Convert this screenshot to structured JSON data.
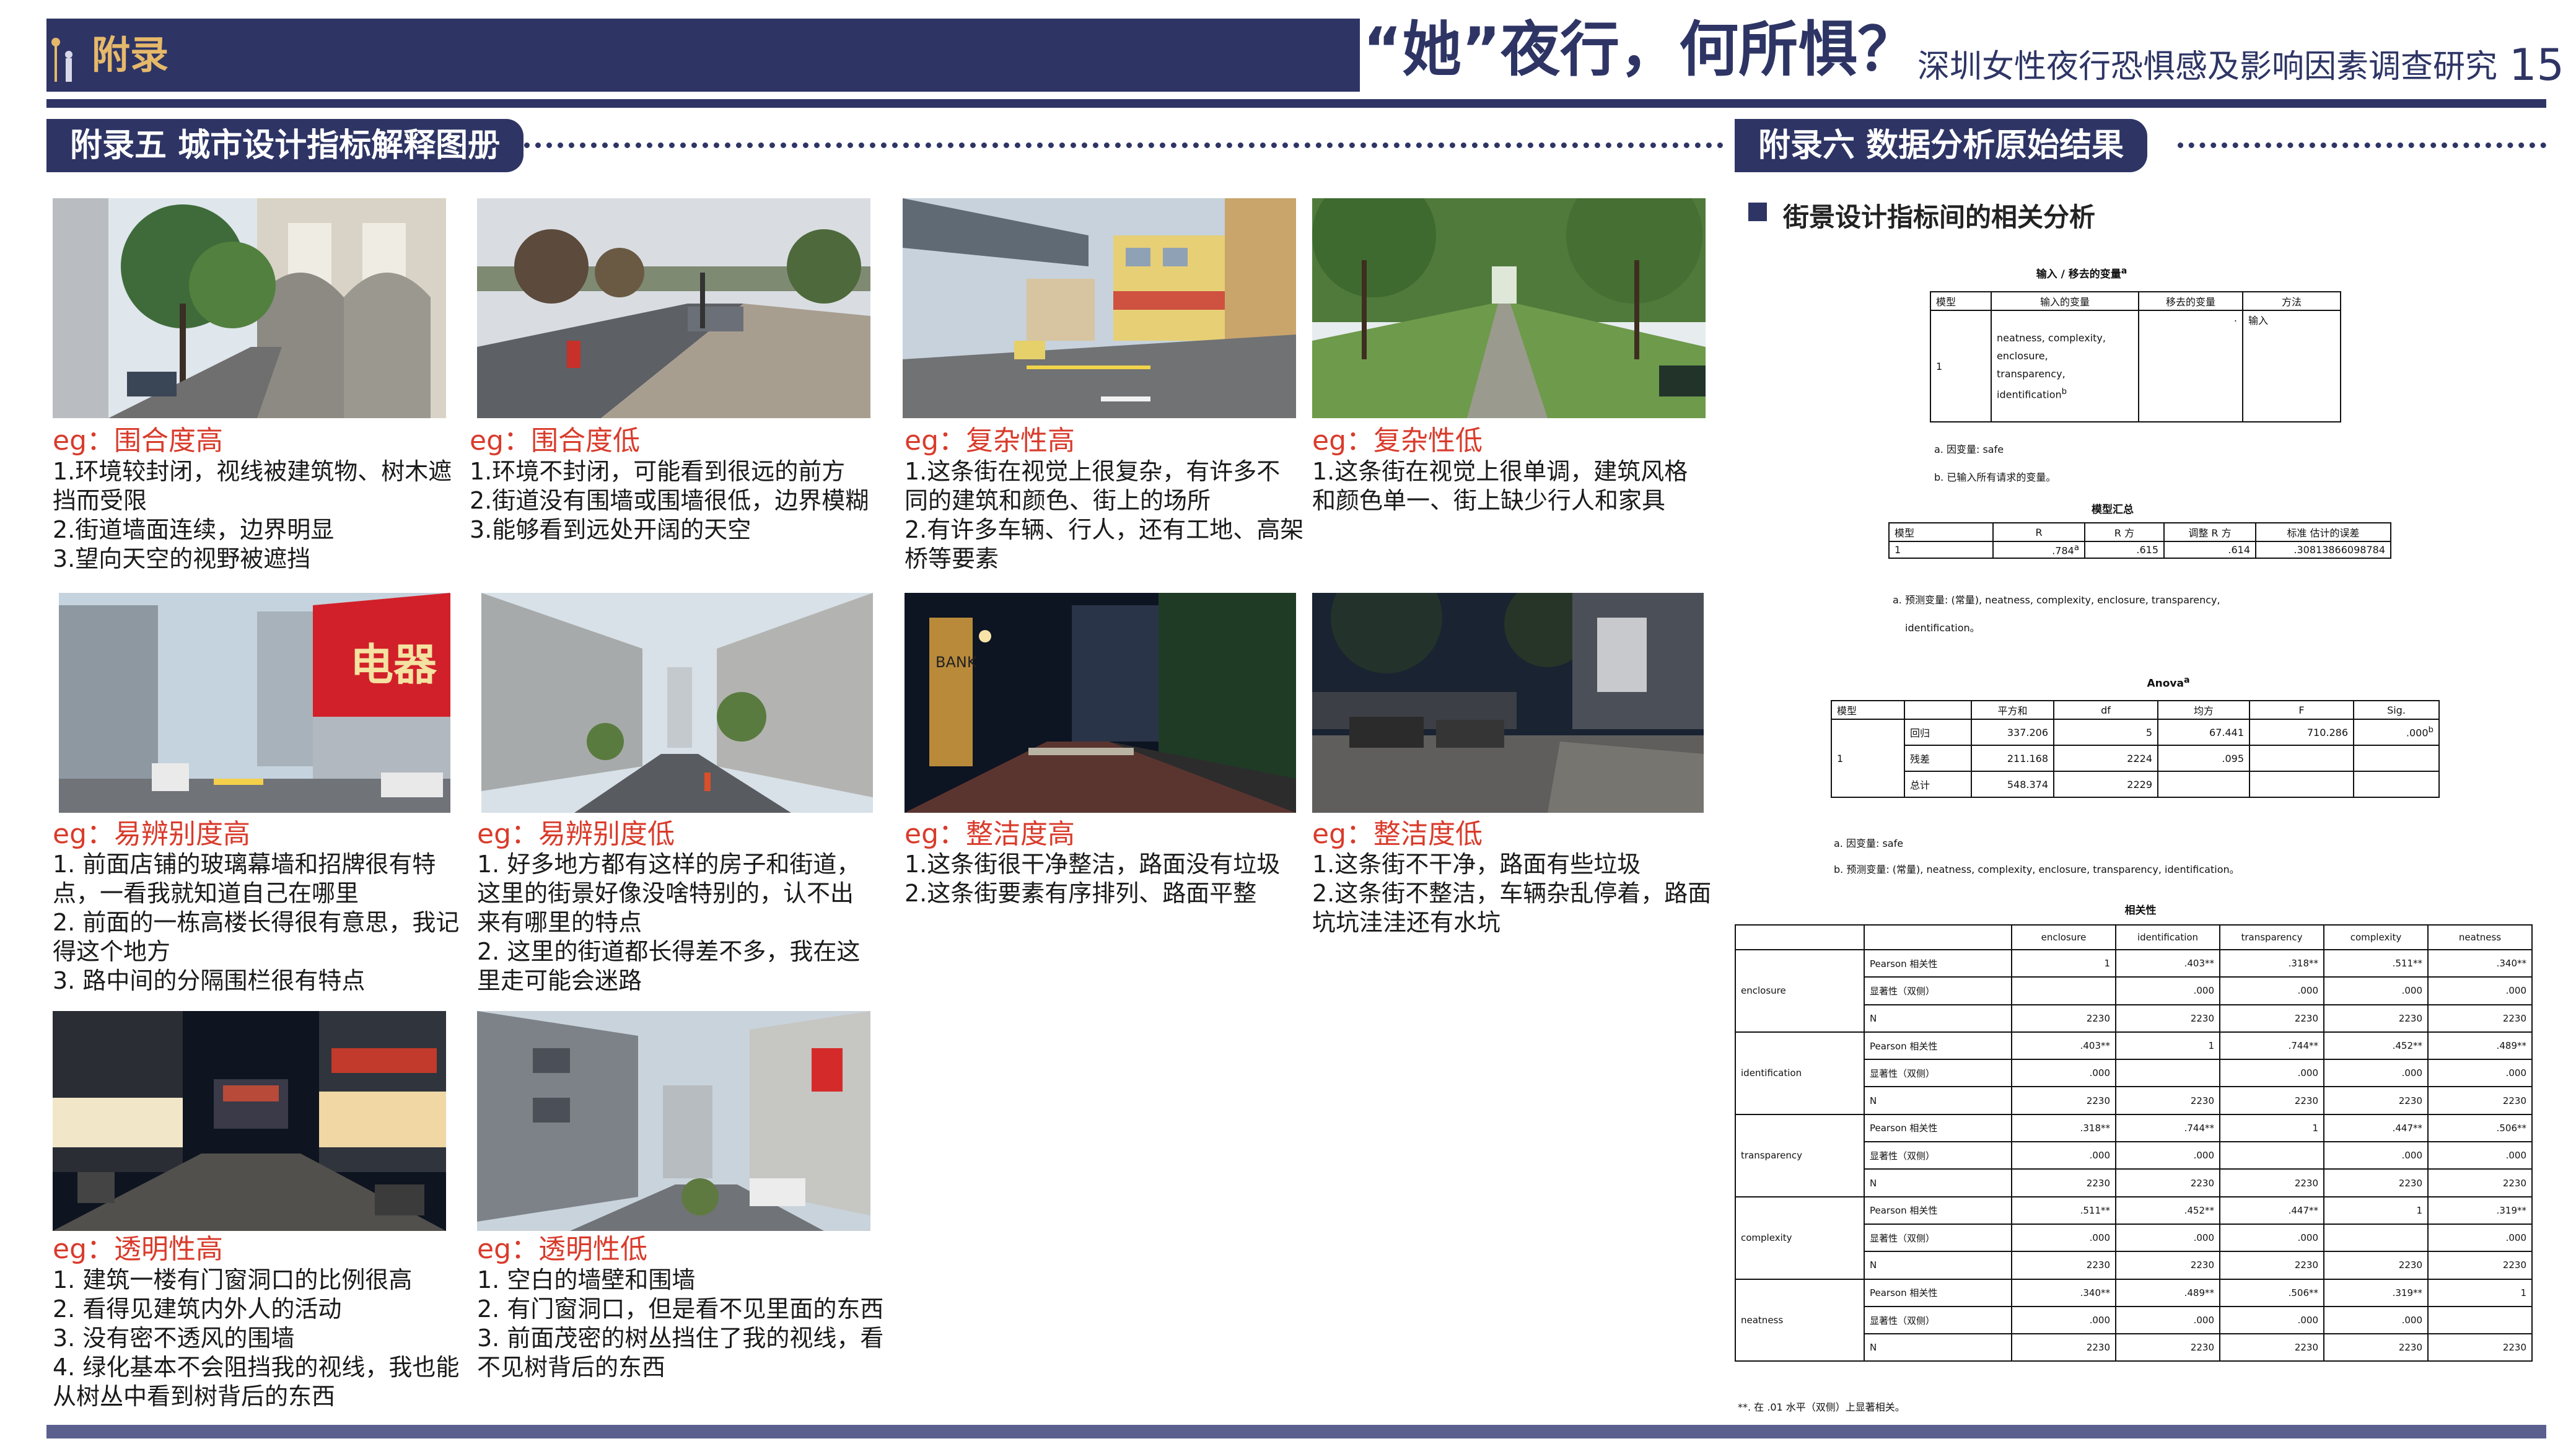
{
  "header": {
    "section": "附录",
    "slogan": "“她”夜行，何所惧？",
    "subtitle": "深圳女性夜行恐惧感及影响因素调查研究",
    "page": "15"
  },
  "appendix5": {
    "title": "附录五 城市设计指标解释图册",
    "cards": [
      {
        "caption": "eg：围合度高",
        "lines": [
          "1.环境较封闭，视线被建筑物、树木遮",
          "挡而受限",
          "2.街道墙面连续，边界明显",
          "3.望向天空的视野被遮挡"
        ]
      },
      {
        "caption": "eg：围合度低",
        "lines": [
          "1.环境不封闭，可能看到很远的前方",
          "2.街道没有围墙或围墙很低，边界模糊",
          "3.能够看到远处开阔的天空"
        ]
      },
      {
        "caption": "eg：复杂性高",
        "lines": [
          "1.这条街在视觉上很复杂，有许多不",
          "同的建筑和颜色、街上的场所",
          "2.有许多车辆、行人，还有工地、高架",
          "桥等要素"
        ]
      },
      {
        "caption": "eg：复杂性低",
        "lines": [
          "1.这条街在视觉上很单调，建筑风格",
          "和颜色单一、街上缺少行人和家具"
        ]
      },
      {
        "caption": "eg：易辨别度高",
        "lines": [
          "1. 前面店铺的玻璃幕墙和招牌很有特",
          "点，一看我就知道自己在哪里",
          "2. 前面的一栋高楼长得很有意思，我记",
          "得这个地方",
          "3. 路中间的分隔围栏很有特点"
        ]
      },
      {
        "caption": "eg：易辨别度低",
        "lines": [
          "1. 好多地方都有这样的房子和街道，",
          "这里的街景好像没啥特别的，认不出",
          "来有哪里的特点",
          "2. 这里的街道都长得差不多，我在这",
          "里走可能会迷路"
        ]
      },
      {
        "caption": "eg：整洁度高",
        "lines": [
          "1.这条街很干净整洁，路面没有垃圾",
          "2.这条街要素有序排列、路面平整"
        ]
      },
      {
        "caption": "eg：整洁度低",
        "lines": [
          "1.这条街不干净，路面有些垃圾",
          "2.这条街不整洁，车辆杂乱停着，路面",
          "坑坑洼洼还有水坑"
        ]
      },
      {
        "caption": "eg：透明性高",
        "lines": [
          "1. 建筑一楼有门窗洞口的比例很高",
          "2. 看得见建筑内外人的活动",
          "3. 没有密不透风的围墙",
          "4. 绿化基本不会阻挡我的视线，我也能",
          "从树丛中看到树背后的东西"
        ]
      },
      {
        "caption": "eg：透明性低",
        "lines": [
          "1. 空白的墙壁和围墙",
          "2. 有门窗洞口，但是看不见里面的东西",
          "3. 前面茂密的树丛挡住了我的视线，看",
          "不见树背后的东西"
        ]
      }
    ],
    "signs": {
      "shop": "电器",
      "bank": "BANK"
    }
  },
  "appendix6": {
    "title": "附录六 数据分析原始结果",
    "subtitle": "街景设计指标间的相关分析",
    "t1": {
      "title": "输入 / 移去的变量",
      "sup": "a",
      "headers": [
        "模型",
        "输入的变量",
        "移去的变量",
        "方法"
      ],
      "model": "1",
      "vars": [
        "neatness, complexity,",
        "enclosure,",
        "transparency,",
        "identification"
      ],
      "vars_sup": "b",
      "removed": ".",
      "method": "输入",
      "notes": [
        "a. 因变量: safe",
        "b. 已输入所有请求的变量。"
      ]
    },
    "t2": {
      "title": "模型汇总",
      "headers": [
        "模型",
        "R",
        "R 方",
        "调整 R 方",
        "标准 估计的误差"
      ],
      "row": [
        "1",
        ".784",
        ".615",
        ".614",
        ".30813866098784"
      ],
      "r_sup": "a",
      "notes": [
        "a. 预测变量: (常量), neatness, complexity, enclosure, transparency,",
        "identification。"
      ]
    },
    "t3": {
      "title": "Anova",
      "sup": "a",
      "headers": [
        "模型",
        "",
        "平方和",
        "df",
        "均方",
        "F",
        "Sig."
      ],
      "model": "1",
      "rows": [
        [
          "回归",
          "337.206",
          "5",
          "67.441",
          "710.286",
          ".000"
        ],
        [
          "残差",
          "211.168",
          "2224",
          ".095",
          "",
          ""
        ],
        [
          "总计",
          "548.374",
          "2229",
          "",
          "",
          ""
        ]
      ],
      "sig_sup": "b",
      "notes": [
        "a. 因变量: safe",
        "b. 预测变量: (常量), neatness, complexity, enclosure, transparency, identification。"
      ]
    },
    "t4": {
      "title": "相关性",
      "cols": [
        "enclosure",
        "identification",
        "transparency",
        "complexity",
        "neatness"
      ],
      "stat_labels": [
        "Pearson 相关性",
        "显著性（双侧）",
        "N"
      ],
      "vars": [
        "enclosure",
        "identification",
        "transparency",
        "complexity",
        "neatness"
      ],
      "pearson": [
        [
          "1",
          ".403**",
          ".318**",
          ".511**",
          ".340**"
        ],
        [
          ".403**",
          "1",
          ".744**",
          ".452**",
          ".489**"
        ],
        [
          ".318**",
          ".744**",
          "1",
          ".447**",
          ".506**"
        ],
        [
          ".511**",
          ".452**",
          ".447**",
          "1",
          ".319**"
        ],
        [
          ".340**",
          ".489**",
          ".506**",
          ".319**",
          "1"
        ]
      ],
      "sig": [
        [
          "",
          ".000",
          ".000",
          ".000",
          ".000"
        ],
        [
          ".000",
          "",
          ".000",
          ".000",
          ".000"
        ],
        [
          ".000",
          ".000",
          "",
          ".000",
          ".000"
        ],
        [
          ".000",
          ".000",
          ".000",
          "",
          ".000"
        ],
        [
          ".000",
          ".000",
          ".000",
          ".000",
          ""
        ]
      ],
      "n": "2230",
      "note": "**. 在 .01 水平（双侧）上显著相关。"
    }
  }
}
